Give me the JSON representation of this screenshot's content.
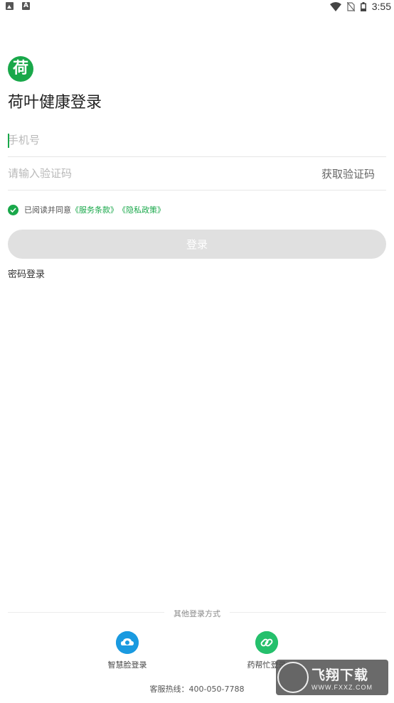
{
  "status_bar": {
    "time": "3:55",
    "left_icons": [
      "image-icon",
      "a-icon"
    ],
    "right_icons": [
      "wifi-icon",
      "no-sim-icon",
      "battery-icon"
    ]
  },
  "app": {
    "logo_char": "荷",
    "title": "荷叶健康登录",
    "brand_color": "#19a84a"
  },
  "form": {
    "phone_placeholder": "手机号",
    "phone_value": "",
    "code_placeholder": "请输入验证码",
    "code_value": "",
    "get_code_label": "获取验证码",
    "agree_prefix": "已阅读并同意",
    "terms_link": "《服务条款》",
    "privacy_link": "《隐私政策》",
    "agree_checked": true,
    "login_label": "登录",
    "password_login_label": "密码登录"
  },
  "other_login": {
    "label": "其他登录方式",
    "options": [
      {
        "label": "智慧脸登录",
        "icon": "cloud-icon",
        "color": "#1a9ae0"
      },
      {
        "label": "药帮忙登录",
        "icon": "link-icon",
        "color": "#25c06c"
      }
    ]
  },
  "hotline": "客服热线：400-050-7788",
  "watermark": {
    "text": "飞翔下载",
    "url": "WWW.FXXZ.COM"
  }
}
